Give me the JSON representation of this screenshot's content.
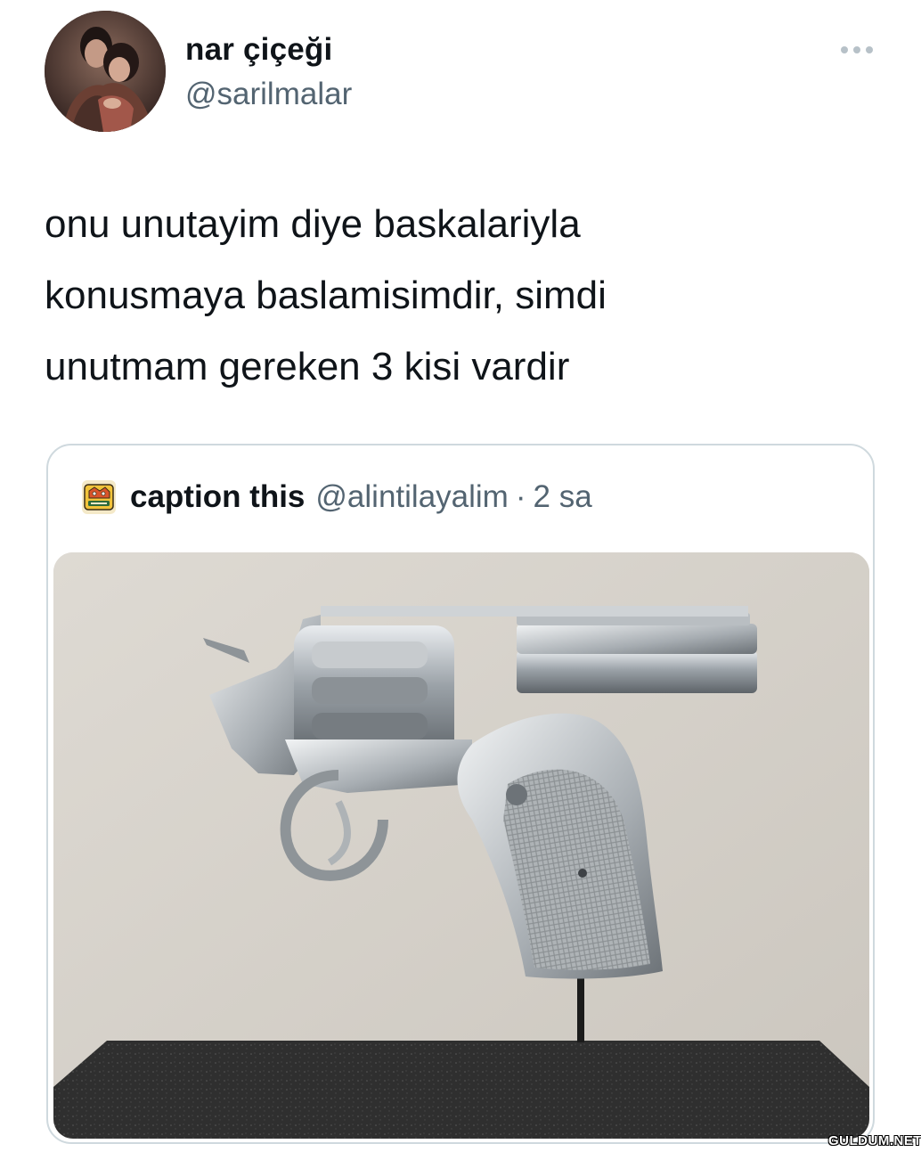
{
  "tweet": {
    "display_name": "nar çiçeği",
    "handle": "@sarilmalar",
    "avatar_icon": "profile-photo-couple",
    "more_icon": "ellipsis-icon",
    "text_lines": [
      "onu unutayim diye baskalariyla",
      "konusmaya baslamisimdir, simdi",
      "unutmam gereken 3 kisi vardir"
    ]
  },
  "quoted_tweet": {
    "display_name": "caption this",
    "handle": "@alintilayalim",
    "separator": "·",
    "time": "2 sa",
    "avatar_icon": "cartoon-logo-avatar",
    "media_description_icon": "revolver-sculpture-photo"
  },
  "watermark": "GULDUM.NET",
  "colors": {
    "text_primary": "#0f1419",
    "text_secondary": "#536471",
    "card_border": "#cfd9de",
    "background": "#ffffff"
  }
}
